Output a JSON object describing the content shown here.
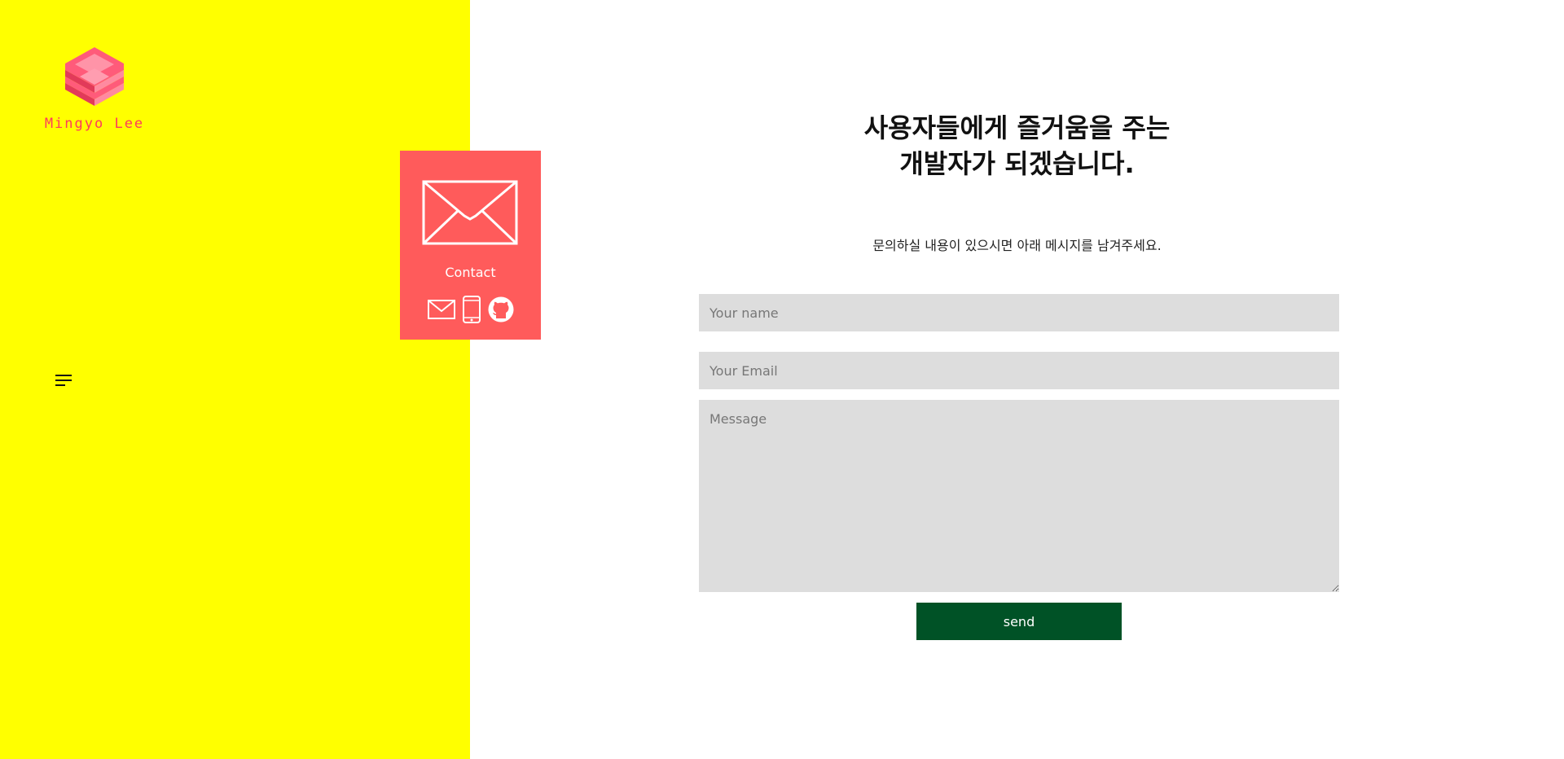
{
  "brand": {
    "name": "Mingyo Lee",
    "logo_icon": "isometric-cube-logo-icon",
    "accent_color": "#ff3b5c"
  },
  "sidebar": {
    "background": "#ffff00",
    "menu_icon": "menu-lines-icon"
  },
  "contact_card": {
    "background": "#ff5b5b",
    "label": "Contact",
    "icons": [
      "envelope-icon",
      "mail-icon",
      "phone-icon",
      "github-icon"
    ]
  },
  "main": {
    "heading_line1": "사용자들에게 즐거움을 주는",
    "heading_line2": "개발자가 되겠습니다.",
    "subtext": "문의하실 내용이 있으시면 아래 메시지를 남겨주세요."
  },
  "form": {
    "name_placeholder": "Your name",
    "email_placeholder": "Your Email",
    "message_placeholder": "Message",
    "send_label": "send",
    "field_background": "#dddddd",
    "button_color": "#005226"
  }
}
